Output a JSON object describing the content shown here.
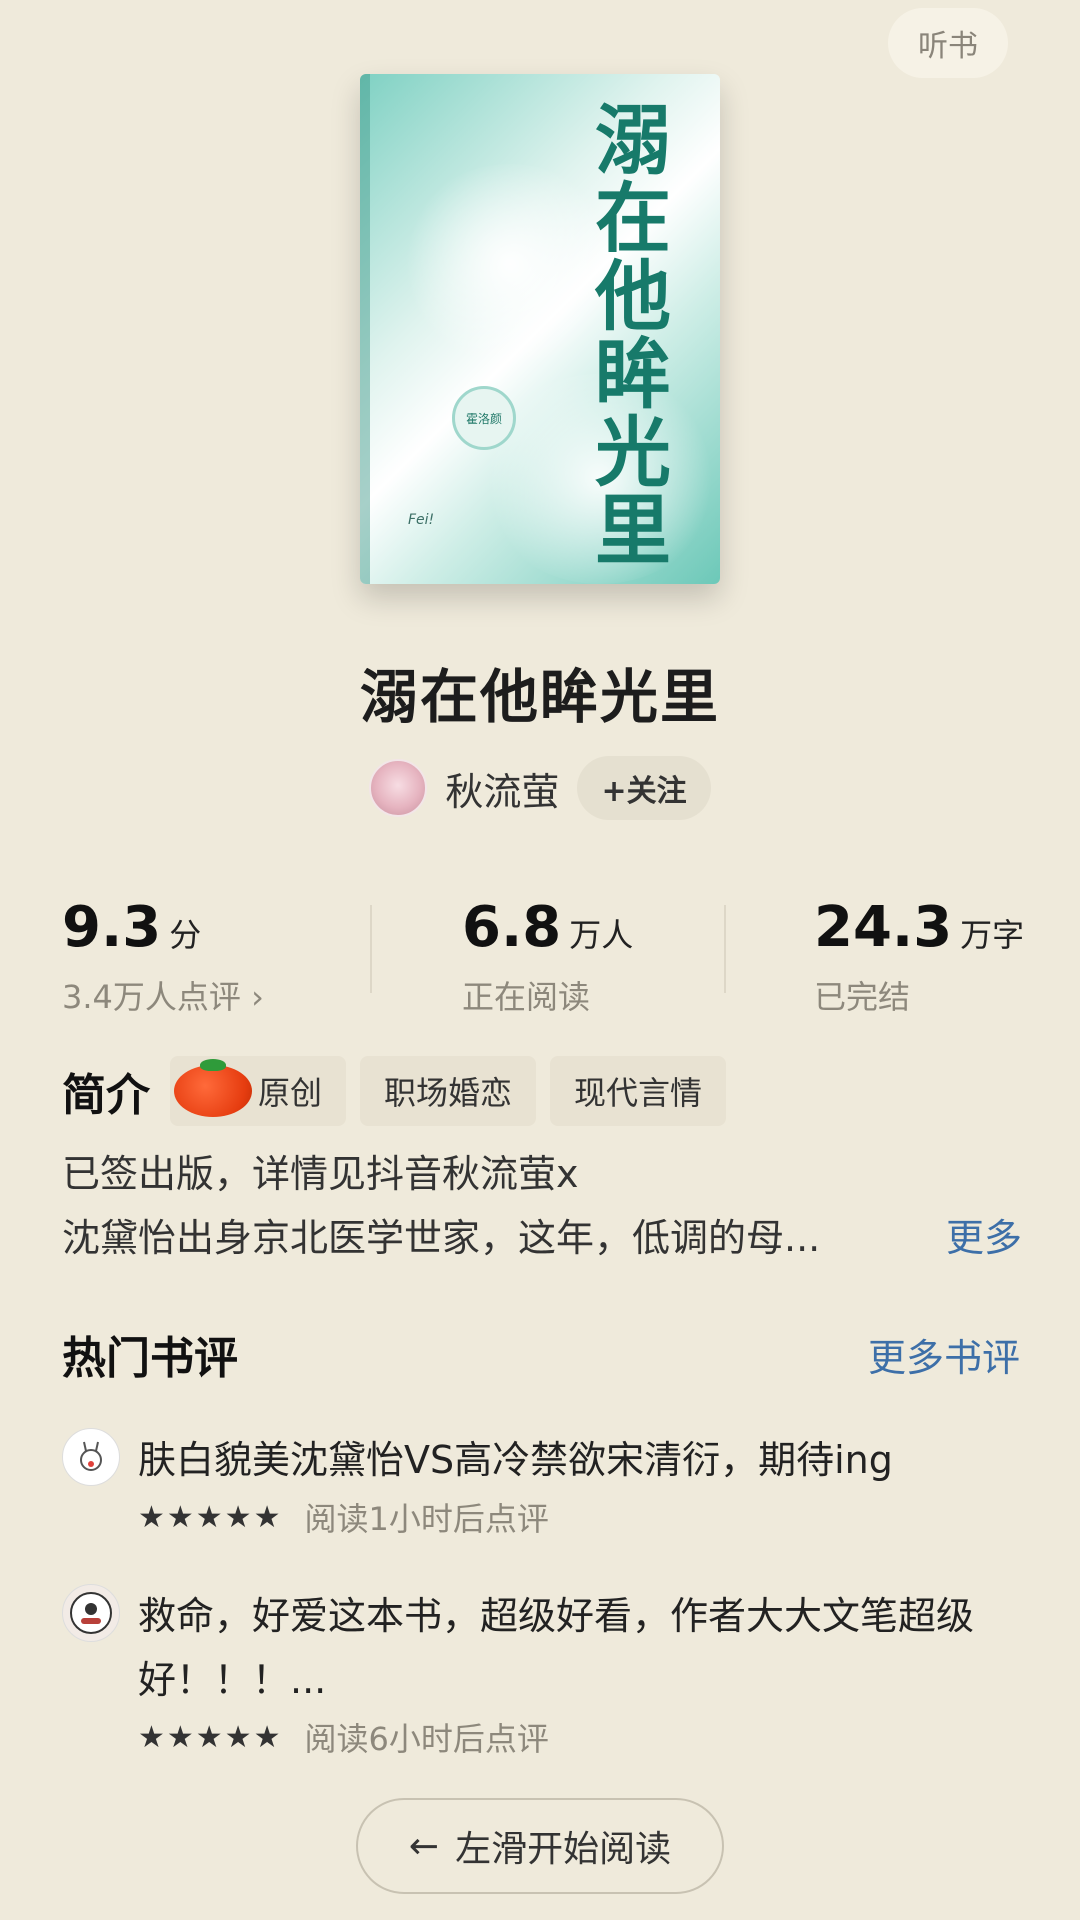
{
  "header": {
    "listen_label": "听书"
  },
  "cover": {
    "title": "溺在他眸光里",
    "badge": "霍洛颜",
    "signature": "Fei!"
  },
  "book": {
    "title": "溺在他眸光里"
  },
  "author": {
    "name": "秋流萤",
    "follow_label": "+关注",
    "avatar_icon": "author-avatar"
  },
  "stats": {
    "rating": {
      "value": "9.3",
      "unit": "分",
      "sub": "3.4万人点评 ›"
    },
    "readers": {
      "value": "6.8",
      "unit": "万人",
      "sub": "正在阅读"
    },
    "words": {
      "value": "24.3",
      "unit": "万字",
      "sub": "已完结"
    }
  },
  "intro": {
    "heading": "简介",
    "tags": [
      "原创",
      "职场婚恋",
      "现代言情"
    ],
    "line1": "已签出版，详情见抖音秋流萤x",
    "line2": "沈黛怡出身京北医学世家，这年，低调的母...",
    "more_label": "更多"
  },
  "reviews": {
    "heading": "热门书评",
    "more_label": "更多书评",
    "items": [
      {
        "text": "肤白貌美沈黛怡VS高冷禁欲宋清衍，期待ing",
        "stars": "★★★★★",
        "time": "阅读1小时后点评"
      },
      {
        "text": "救命，好爱这本书，超级好看，作者大大文笔超级好！！！...",
        "stars": "★★★★★",
        "time": "阅读6小时后点评"
      }
    ]
  },
  "footer": {
    "start_label": "左滑开始阅读",
    "arrow_icon": "←"
  },
  "colors": {
    "background": "#efeadb",
    "link": "#3d6fa8",
    "cover_text": "#177a6a"
  }
}
